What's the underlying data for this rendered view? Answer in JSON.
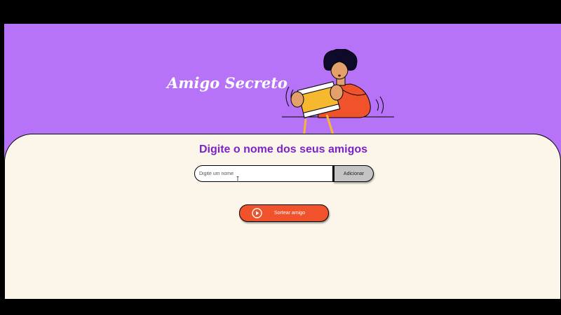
{
  "header": {
    "title": "Amigo Secreto"
  },
  "main": {
    "title": "Digite o nome dos seus amigos",
    "name_input": {
      "placeholder": "Digite um nome",
      "value": ""
    },
    "add_button_label": "Adicionar",
    "draw_button_label": "Sortear amigo"
  },
  "colors": {
    "header_bg": "#B673F8",
    "main_bg": "#FCF6EA",
    "title_purple": "#7C23C4",
    "draw_button": "#F0522B",
    "add_button": "#C4C4C4"
  },
  "icons": {
    "illustration": "person-holding-gift-illustration",
    "play": "play-circle-icon",
    "cursor": "text-cursor-icon"
  }
}
